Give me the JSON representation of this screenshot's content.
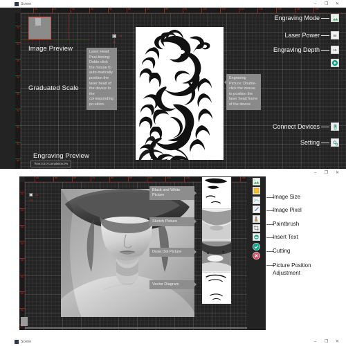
{
  "windows": {
    "top": {
      "title": "Scene",
      "controls": {
        "minimize": "–",
        "maximize": "❐",
        "close": "✕"
      }
    },
    "middle": {
      "title": "Scene",
      "controls": {
        "minimize": "–",
        "maximize": "❐",
        "close": "✕"
      }
    },
    "bottom": {
      "title": "Scene",
      "controls": {
        "minimize": "–",
        "maximize": "❐",
        "close": "✕"
      }
    }
  },
  "panel1": {
    "labels": {
      "image_preview": "Image Preview",
      "graduated_scale": "Graduated Scale",
      "engraving_preview": "Engraving Preview"
    },
    "status_bar": "Time:0:0:0  Completion:0%",
    "callouts": {
      "laser_head": "Laser Head Posi-tioning: Doble-click the mouse to auto-matically position the laser head of the device to the corresponding po-sition.",
      "engraving_picture": "Engraving Picture: Double-click the mouse to position the laser head frame of the device"
    },
    "crosshair_value": "14",
    "crosshair_value_v": "25",
    "ruler_h_ticks": [
      "10",
      "20",
      "30",
      "40",
      "50",
      "60",
      "70",
      "80",
      "90",
      "100",
      "110",
      "120",
      "130",
      "140",
      "150",
      "160"
    ],
    "ruler_v_ticks": [
      "22",
      "23",
      "30",
      "32",
      "40",
      "42",
      "50",
      "52",
      "60"
    ],
    "controls": [
      {
        "label": "Engraving Mode",
        "value": "",
        "icon": "mountain-icon"
      },
      {
        "label": "Laser Power",
        "value": "90",
        "icon": "value-box"
      },
      {
        "label": "Engraving Depth",
        "value": "15",
        "icon": "value-box"
      },
      {
        "label": "",
        "value": "",
        "icon": "play-icon"
      },
      {
        "label": "Connect Devices",
        "value": "",
        "icon": "usb-icon"
      },
      {
        "label": "Setting",
        "value": "",
        "icon": "gear-icon"
      }
    ]
  },
  "panel2": {
    "crosshair_value": "13",
    "crosshair_value_v": "23",
    "ruler_h_ticks": [
      "40",
      "50",
      "60",
      "70",
      "80",
      "90",
      "100",
      "110",
      "120",
      "130",
      "140",
      "150",
      "160"
    ],
    "callouts": [
      "Black and White\nPicture",
      "Sketch Picture",
      "Draw Dot Picture",
      "Vector Diagram"
    ],
    "tools": [
      {
        "name": "",
        "icon": "mountain-icon",
        "label": ""
      },
      {
        "name": "image-size",
        "icon": "square-yellow-icon",
        "label": "Image Size"
      },
      {
        "name": "image-pixel",
        "icon": "pixel-icon",
        "label": "Image Pixel"
      },
      {
        "name": "paintbrush",
        "icon": "paintbrush-icon",
        "label": "Paintbrush"
      },
      {
        "name": "insert-text",
        "icon": "insert-text-icon",
        "label": "Insert Text"
      },
      {
        "name": "cutting",
        "icon": "crop-icon",
        "label": "Cutting"
      },
      {
        "name": "picture-position-adjustment",
        "icon": "position-icon",
        "label": "Picture Position\nAdjustment"
      },
      {
        "name": "confirm",
        "icon": "check-icon",
        "label": ""
      },
      {
        "name": "cancel",
        "icon": "cancel-icon",
        "label": ""
      }
    ]
  },
  "colors": {
    "canvas": "#232323",
    "ruler_red": "#c0392b",
    "accent_green": "#16a085",
    "callout_gray": "#8a8a8a",
    "panel_white": "#ffffff"
  }
}
